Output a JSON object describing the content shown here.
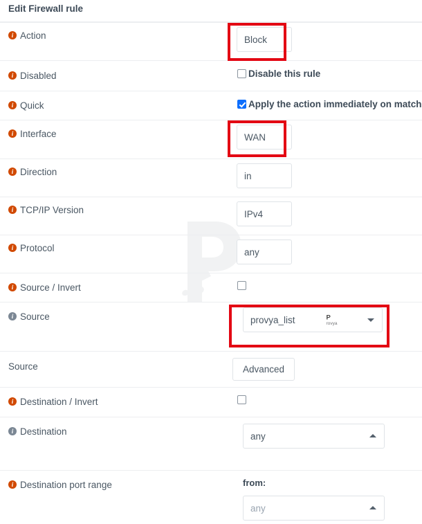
{
  "header": {
    "title": "Edit Firewall rule"
  },
  "colors": {
    "info_icon": "#d14900",
    "info_icon_muted": "#7b8794",
    "highlight": "#e30613",
    "checkbox_checked": "#0d6efd",
    "label_text": "#4a5763",
    "field_border": "#dfe3e7",
    "row_divider": "#eceef0"
  },
  "rows": [
    {
      "label": "Action",
      "icon": "info-icon",
      "icon_muted": false,
      "control": "select",
      "value": "Block",
      "highlighted": true
    },
    {
      "label": "Disabled",
      "icon": "info-icon",
      "icon_muted": false,
      "control": "checkbox",
      "checkbox_label": "Disable this rule",
      "checked": false,
      "highlighted": false
    },
    {
      "label": "Quick",
      "icon": "info-icon",
      "icon_muted": false,
      "control": "checkbox",
      "checkbox_label": "Apply the action immediately on match.",
      "checked": true,
      "highlighted": false
    },
    {
      "label": "Interface",
      "icon": "info-icon",
      "icon_muted": false,
      "control": "select",
      "value": "WAN",
      "highlighted": true
    },
    {
      "label": "Direction",
      "icon": "info-icon",
      "icon_muted": false,
      "control": "select",
      "value": "in",
      "highlighted": false
    },
    {
      "label": "TCP/IP Version",
      "icon": "info-icon",
      "icon_muted": false,
      "control": "select",
      "value": "IPv4",
      "highlighted": false
    },
    {
      "label": "Protocol",
      "icon": "info-icon",
      "icon_muted": false,
      "control": "select",
      "value": "any",
      "highlighted": false
    },
    {
      "label": "Source / Invert",
      "icon": "info-icon",
      "icon_muted": false,
      "control": "checkbox-only",
      "checked": false,
      "highlighted": false
    },
    {
      "label": "Source",
      "icon": "info-icon",
      "icon_muted": true,
      "control": "select-dropdown",
      "value": "provya_list",
      "caret": "chevron-down-icon",
      "highlighted": true,
      "watermark": "provya-logo"
    },
    {
      "label": "Source",
      "icon": null,
      "icon_muted": false,
      "control": "button",
      "button_label": "Advanced",
      "highlighted": false
    },
    {
      "label": "Destination / Invert",
      "icon": "info-icon",
      "icon_muted": false,
      "control": "checkbox-only",
      "checked": false,
      "highlighted": false
    },
    {
      "label": "Destination",
      "icon": "info-icon",
      "icon_muted": true,
      "control": "select-up",
      "value": "any",
      "caret": "chevron-up-icon",
      "highlighted": false
    },
    {
      "label": "Destination port range",
      "icon": "info-icon",
      "icon_muted": false,
      "control": "port-range",
      "from_label": "from:",
      "from_value": "any",
      "caret": "chevron-up-icon",
      "highlighted": false
    }
  ],
  "watermark": {
    "letter": "P",
    "brand": "Provya"
  }
}
